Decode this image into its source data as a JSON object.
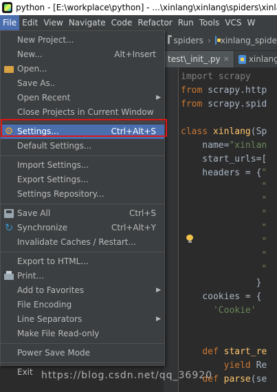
{
  "window": {
    "title": "python - [E:\\workplace\\python] - ...\\xinlang\\xinlang\\spiders\\xinlang"
  },
  "menubar": {
    "items": [
      "File",
      "Edit",
      "View",
      "Navigate",
      "Code",
      "Refactor",
      "Run",
      "Tools",
      "VCS",
      "W"
    ],
    "active": "File"
  },
  "navbar": {
    "items": [
      "spiders",
      "xinlang_spide"
    ]
  },
  "tabs": [
    {
      "label": "test\\_init_.py",
      "closable": true
    },
    {
      "label": "xinlang",
      "closable": false
    }
  ],
  "editor": {
    "lines": [
      {
        "parts": [
          {
            "t": "import scrapy",
            "c": "dim"
          }
        ]
      },
      {
        "parts": [
          {
            "t": "from",
            "c": "kw"
          },
          {
            "t": " scrapy.http",
            "c": ""
          }
        ]
      },
      {
        "parts": [
          {
            "t": "from",
            "c": "kw"
          },
          {
            "t": " scrapy.spid",
            "c": ""
          }
        ]
      },
      {
        "parts": [
          {
            "t": "",
            "c": ""
          }
        ]
      },
      {
        "parts": [
          {
            "t": "class",
            "c": "kw"
          },
          {
            "t": " ",
            "c": ""
          },
          {
            "t": "xinlang",
            "c": "cls"
          },
          {
            "t": "(Sp",
            "c": ""
          }
        ]
      },
      {
        "parts": [
          {
            "t": "    name=",
            "c": ""
          },
          {
            "t": "\"xinlan",
            "c": "str"
          }
        ]
      },
      {
        "parts": [
          {
            "t": "    start_urls=[",
            "c": ""
          }
        ]
      },
      {
        "parts": [
          {
            "t": "    headers = {",
            "c": ""
          },
          {
            "t": "\"",
            "c": "str"
          }
        ]
      },
      {
        "parts": [
          {
            "t": "               \"",
            "c": "str"
          }
        ]
      },
      {
        "parts": [
          {
            "t": "               \"",
            "c": "str"
          }
        ]
      },
      {
        "parts": [
          {
            "t": "               \"",
            "c": "str"
          }
        ]
      },
      {
        "parts": [
          {
            "t": "               \"",
            "c": "str"
          }
        ]
      },
      {
        "parts": [
          {
            "t": "               \"",
            "c": "str"
          }
        ]
      },
      {
        "parts": [
          {
            "t": "               \"",
            "c": "str"
          }
        ]
      },
      {
        "parts": [
          {
            "t": "               \"",
            "c": "str"
          }
        ]
      },
      {
        "parts": [
          {
            "t": "              }",
            "c": ""
          }
        ]
      },
      {
        "parts": [
          {
            "t": "    cookies = {",
            "c": ""
          }
        ]
      },
      {
        "parts": [
          {
            "t": "      ",
            "c": ""
          },
          {
            "t": "'Cookie'",
            "c": "str"
          }
        ]
      },
      {
        "parts": [
          {
            "t": "",
            "c": ""
          }
        ]
      },
      {
        "parts": [
          {
            "t": "",
            "c": ""
          }
        ]
      },
      {
        "parts": [
          {
            "t": "    ",
            "c": ""
          },
          {
            "t": "def",
            "c": "kw"
          },
          {
            "t": " ",
            "c": ""
          },
          {
            "t": "start_re",
            "c": "cls"
          }
        ]
      },
      {
        "parts": [
          {
            "t": "        ",
            "c": ""
          },
          {
            "t": "yield",
            "c": "kw"
          },
          {
            "t": " Re",
            "c": ""
          }
        ]
      },
      {
        "parts": [
          {
            "t": "    ",
            "c": ""
          },
          {
            "t": "def",
            "c": "kw"
          },
          {
            "t": " ",
            "c": ""
          },
          {
            "t": "parse",
            "c": "cls"
          },
          {
            "t": "(se",
            "c": ""
          }
        ]
      }
    ]
  },
  "file_menu": {
    "items": [
      {
        "label": "New Project...",
        "shortcut": "",
        "icon": "",
        "submenu": false
      },
      {
        "label": "New...",
        "shortcut": "Alt+Insert",
        "icon": "",
        "submenu": false
      },
      {
        "label": "Open...",
        "shortcut": "",
        "icon": "folder-icon",
        "submenu": false
      },
      {
        "label": "Save As..",
        "shortcut": "",
        "icon": "",
        "submenu": false
      },
      {
        "label": "Open Recent",
        "shortcut": "",
        "icon": "",
        "submenu": true
      },
      {
        "label": "Close Projects in Current Window",
        "shortcut": "",
        "icon": "",
        "submenu": false
      },
      {
        "sep": true
      },
      {
        "label": "Settings...",
        "shortcut": "Ctrl+Alt+S",
        "icon": "gear-icon",
        "submenu": false,
        "selected": true
      },
      {
        "label": "Default Settings...",
        "shortcut": "",
        "icon": "",
        "submenu": false
      },
      {
        "sep": true
      },
      {
        "label": "Import Settings...",
        "shortcut": "",
        "icon": "",
        "submenu": false
      },
      {
        "label": "Export Settings...",
        "shortcut": "",
        "icon": "",
        "submenu": false
      },
      {
        "label": "Settings Repository...",
        "shortcut": "",
        "icon": "",
        "submenu": false
      },
      {
        "sep": true
      },
      {
        "label": "Save All",
        "shortcut": "Ctrl+S",
        "icon": "save-icon",
        "submenu": false
      },
      {
        "label": "Synchronize",
        "shortcut": "Ctrl+Alt+Y",
        "icon": "sync-icon",
        "submenu": false
      },
      {
        "label": "Invalidate Caches / Restart...",
        "shortcut": "",
        "icon": "",
        "submenu": false
      },
      {
        "sep": true
      },
      {
        "label": "Export to HTML...",
        "shortcut": "",
        "icon": "",
        "submenu": false
      },
      {
        "label": "Print...",
        "shortcut": "",
        "icon": "print-icon",
        "submenu": false
      },
      {
        "label": "Add to Favorites",
        "shortcut": "",
        "icon": "",
        "submenu": true
      },
      {
        "label": "File Encoding",
        "shortcut": "",
        "icon": "",
        "submenu": false
      },
      {
        "label": "Line Separators",
        "shortcut": "",
        "icon": "",
        "submenu": true
      },
      {
        "label": "Make File Read-only",
        "shortcut": "",
        "icon": "",
        "submenu": false
      },
      {
        "sep": true
      },
      {
        "label": "Power Save Mode",
        "shortcut": "",
        "icon": "",
        "submenu": false
      },
      {
        "sep": true
      },
      {
        "label": "Exit",
        "shortcut": "",
        "icon": "",
        "submenu": false
      }
    ]
  },
  "watermark": "https://blog.csdn.net/qq_36920"
}
